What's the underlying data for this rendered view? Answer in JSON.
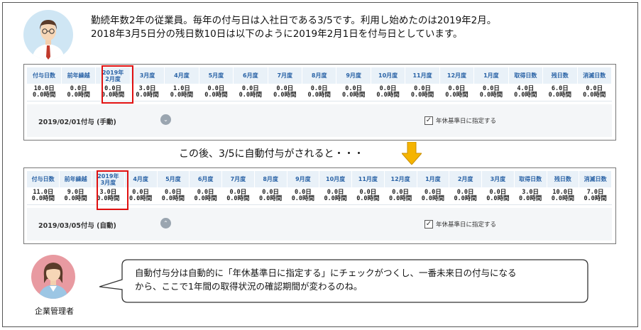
{
  "intro": {
    "line1": "勤続年数2年の従業員。毎年の付与日は入社日である3/5です。利用し始めたのは2019年2月。",
    "line2": "2018年3月5日分の残日数10日は以下のように2019年2月1日を付与日としています。"
  },
  "table1": {
    "headers": [
      "付与日数",
      "前年繰越",
      "2019年\n2月度",
      "3月度",
      "4月度",
      "5月度",
      "6月度",
      "7月度",
      "8月度",
      "9月度",
      "10月度",
      "11月度",
      "12月度",
      "1月度",
      "取得日数",
      "残日数",
      "消滅日数"
    ],
    "days": [
      "10.0日",
      "0.0日",
      "0.0日",
      "3.0日",
      "1.0日",
      "0.0日",
      "0.0日",
      "0.0日",
      "0.0日",
      "0.0日",
      "0.0日",
      "0.0日",
      "0.0日",
      "0.0日",
      "4.0日",
      "6.0日",
      "0.0日"
    ],
    "hours": [
      "0.0時間",
      "0.0時間",
      "0.0時間",
      "0.0時間",
      "0.0時間",
      "0.0時間",
      "0.0時間",
      "0.0時間",
      "0.0時間",
      "0.0時間",
      "0.0時間",
      "0.0時間",
      "0.0時間",
      "0.0時間",
      "0.0時間",
      "0.0時間",
      "0.0時間"
    ],
    "grant_label": "2019/02/01付与 (手動)",
    "checkbox_label": "年休基準日に指定する",
    "checkbox_checked": true
  },
  "middle_text": "この後、3/5に自動付与がされると・・・",
  "table2": {
    "headers": [
      "付与日数",
      "前年繰越",
      "2019年\n3月度",
      "4月度",
      "5月度",
      "6月度",
      "7月度",
      "8月度",
      "9月度",
      "10月度",
      "11月度",
      "12月度",
      "1月度",
      "2月度",
      "3月度",
      "取得日数",
      "残日数",
      "消滅日数"
    ],
    "days": [
      "11.0日",
      "9.0日",
      "3.0日",
      "0.0日",
      "0.0日",
      "0.0日",
      "0.0日",
      "0.0日",
      "0.0日",
      "0.0日",
      "0.0日",
      "0.0日",
      "0.0日",
      "0.0日",
      "0.0日",
      "3.0日",
      "10.0日",
      "7.0日"
    ],
    "hours": [
      "0.0時間",
      "0.0時間",
      "0.0時間",
      "0.0時間",
      "0.0時間",
      "0.0時間",
      "0.0時間",
      "0.0時間",
      "0.0時間",
      "0.0時間",
      "0.0時間",
      "0.0時間",
      "0.0時間",
      "0.0時間",
      "0.0時間",
      "0.0時間",
      "0.0時間",
      "0.0時間"
    ],
    "grant_label": "2019/03/05付与 (自動)",
    "checkbox_label": "年休基準日に指定する",
    "checkbox_checked": true
  },
  "bubble": {
    "line1": "自動付与分は自動的に「年休基準日に指定する」にチェックがつくし、一番未来日の付与になる",
    "line2": "から、ここで1年間の取得状況の確認期間が変わるのね。"
  },
  "manager_label": "企業管理者",
  "icons": {
    "expand": "chevron-down-icon",
    "collapse": "chevron-up-icon",
    "arrow": "down-arrow-icon",
    "check": "check-icon"
  },
  "colors": {
    "highlight": "#e01010",
    "header_text": "#2a63a6",
    "header_bg": "#e9f1f8",
    "arrow": "#f5b400"
  }
}
